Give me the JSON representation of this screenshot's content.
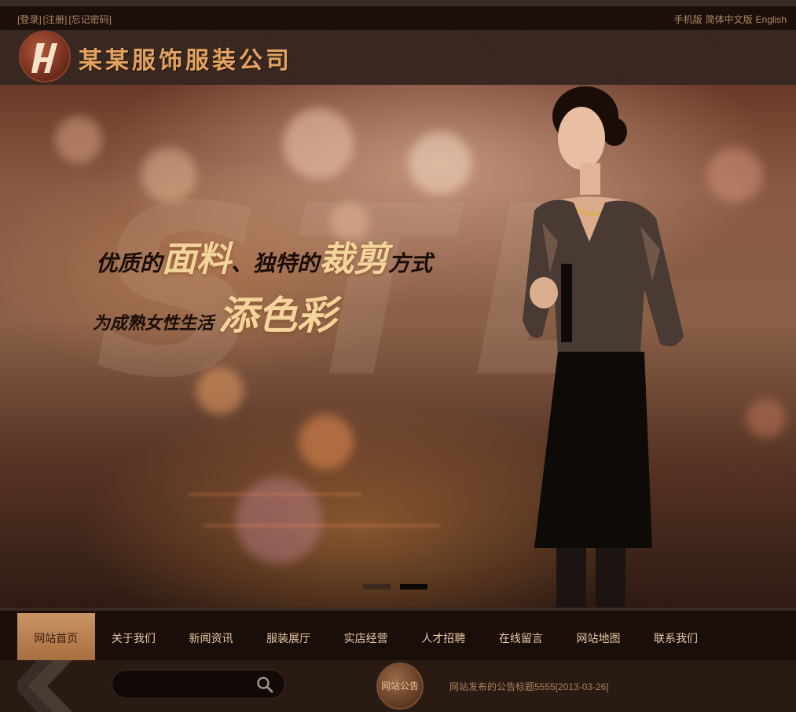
{
  "topbar": {
    "login": "[登录]",
    "register": "[注册]",
    "forgot": "[忘记密码]",
    "mobile": "手机版",
    "simplified": "简体中文版",
    "english": "English"
  },
  "header": {
    "company_name": "某某服饰服装公司"
  },
  "banner": {
    "line1_a": "优质的",
    "line1_b": "面料",
    "line1_c": "、独特的",
    "line1_d": "裁剪",
    "line1_e": "方式",
    "line2_a": "为成熟女性生活",
    "line2_b": "添色彩",
    "slides_total": 2,
    "active_slide": 2
  },
  "nav": {
    "items": [
      {
        "label": "网站首页",
        "active": true
      },
      {
        "label": "关于我们",
        "active": false
      },
      {
        "label": "新闻资讯",
        "active": false
      },
      {
        "label": "服装展厅",
        "active": false
      },
      {
        "label": "实店经营",
        "active": false
      },
      {
        "label": "人才招聘",
        "active": false
      },
      {
        "label": "在线留言",
        "active": false
      },
      {
        "label": "网站地图",
        "active": false
      },
      {
        "label": "联系我们",
        "active": false
      }
    ]
  },
  "bottombar": {
    "search_placeholder": "",
    "notice_label": "网站公告",
    "notice_text": "网站发布的公告标题5555[2013-03-26]"
  },
  "colors": {
    "accent": "#c99464",
    "brand_text": "#e3a360",
    "nav_bg": "#1a0e0a"
  }
}
